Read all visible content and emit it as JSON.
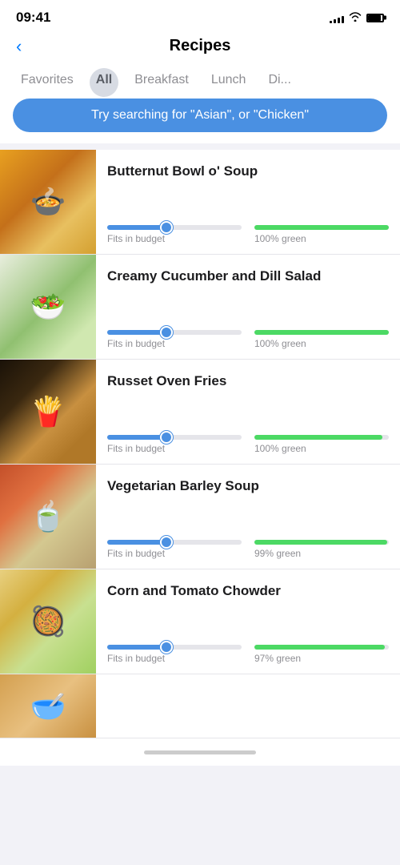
{
  "statusBar": {
    "time": "09:41",
    "signal": [
      3,
      5,
      7,
      9,
      11
    ],
    "battery": 90
  },
  "header": {
    "title": "Recipes",
    "backLabel": "‹"
  },
  "tabs": {
    "items": [
      {
        "id": "favorites",
        "label": "Favorites",
        "active": false
      },
      {
        "id": "all",
        "label": "All",
        "active": true
      },
      {
        "id": "breakfast",
        "label": "Breakfast",
        "active": false
      },
      {
        "id": "lunch",
        "label": "Lunch",
        "active": false
      },
      {
        "id": "dinner",
        "label": "Di...",
        "active": false
      }
    ]
  },
  "searchBar": {
    "placeholder": "Try searching for \"Asian\", or \"Chicken\""
  },
  "recipes": [
    {
      "id": "butternut-soup",
      "name": "Butternut Bowl o' Soup",
      "budgetLabel": "Fits in budget",
      "greenLabel": "100% green",
      "budgetPercent": 45,
      "greenPercent": 100,
      "imageClass": "img-soup",
      "imageEmoji": "🍲"
    },
    {
      "id": "cucumber-salad",
      "name": "Creamy Cucumber and Dill Salad",
      "budgetLabel": "Fits in budget",
      "greenLabel": "100% green",
      "budgetPercent": 45,
      "greenPercent": 100,
      "imageClass": "img-salad",
      "imageEmoji": "🥗"
    },
    {
      "id": "russet-fries",
      "name": "Russet Oven Fries",
      "budgetLabel": "Fits in budget",
      "greenLabel": "100% green",
      "budgetPercent": 45,
      "greenPercent": 95,
      "imageClass": "img-fries",
      "imageEmoji": "🍟"
    },
    {
      "id": "vegetarian-barley",
      "name": "Vegetarian Barley Soup",
      "budgetLabel": "Fits in budget",
      "greenLabel": "99% green",
      "budgetPercent": 45,
      "greenPercent": 99,
      "imageClass": "img-barley",
      "imageEmoji": "🍵"
    },
    {
      "id": "corn-chowder",
      "name": "Corn and Tomato Chowder",
      "budgetLabel": "Fits in budget",
      "greenLabel": "97% green",
      "budgetPercent": 45,
      "greenPercent": 97,
      "imageClass": "img-chowder",
      "imageEmoji": "🥘"
    }
  ]
}
